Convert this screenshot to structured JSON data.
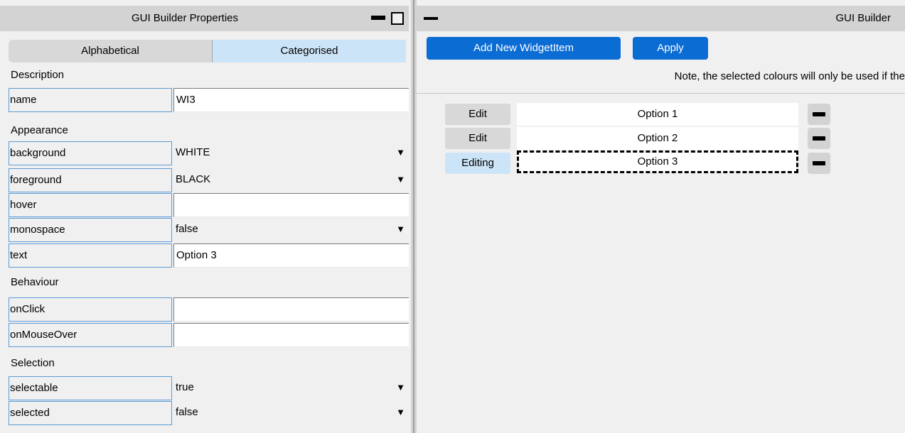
{
  "left": {
    "title": "GUI Builder Properties",
    "tabs": {
      "alphabetical": "Alphabetical",
      "categorised": "Categorised"
    },
    "sections": {
      "description": "Description",
      "appearance": "Appearance",
      "behaviour": "Behaviour",
      "selection": "Selection"
    },
    "props": {
      "name": {
        "label": "name",
        "value": "WI3"
      },
      "background": {
        "label": "background",
        "value": "WHITE"
      },
      "foreground": {
        "label": "foreground",
        "value": "BLACK"
      },
      "hover": {
        "label": "hover",
        "value": ""
      },
      "monospace": {
        "label": "monospace",
        "value": "false"
      },
      "text": {
        "label": "text",
        "value": "Option 3"
      },
      "onClick": {
        "label": "onClick",
        "value": ""
      },
      "onMouseOver": {
        "label": "onMouseOver",
        "value": ""
      },
      "selectable": {
        "label": "selectable",
        "value": "true"
      },
      "selected": {
        "label": "selected",
        "value": "false"
      }
    },
    "dropdown_glyph": "▼"
  },
  "right": {
    "title": "GUI Builder",
    "buttons": {
      "add": "Add New WidgetItem",
      "apply": "Apply"
    },
    "note": "Note, the selected colours will only be used if the",
    "items": [
      {
        "edit_label": "Edit",
        "text": "Option 1"
      },
      {
        "edit_label": "Edit",
        "text": "Option 2"
      },
      {
        "edit_label": "Editing",
        "text": "Option 3"
      }
    ]
  },
  "colors": {
    "accent_blue": "#0b6cd4",
    "selected_tab": "#cce4f7",
    "field_border": "#5b9bd5"
  }
}
